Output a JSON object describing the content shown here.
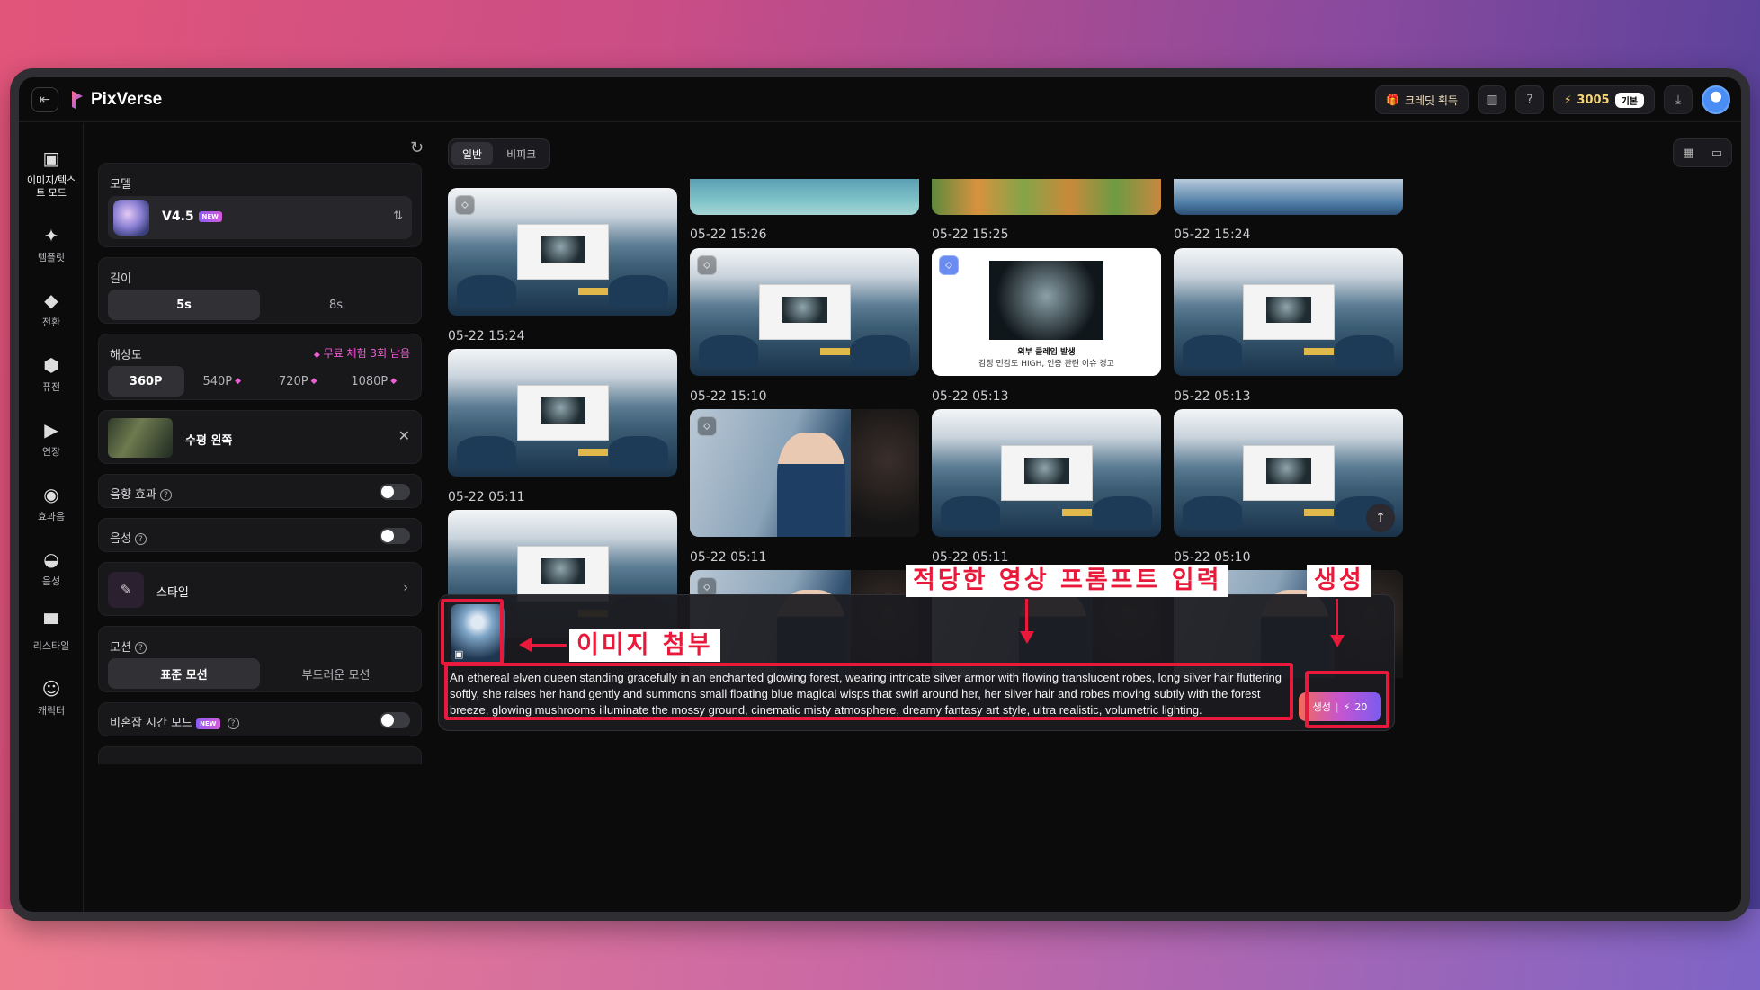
{
  "app": {
    "name": "PixVerse",
    "credits_label": "크레딧 획득",
    "credit_count": "3005",
    "plan": "기본"
  },
  "sidebar": {
    "items": [
      {
        "label": "이미지/텍스트 모드",
        "icon": "image-icon",
        "active": true
      },
      {
        "label": "템플릿",
        "icon": "sparkle-icon"
      },
      {
        "label": "전환",
        "icon": "transition-icon"
      },
      {
        "label": "퓨전",
        "icon": "cube-icon"
      },
      {
        "label": "연장",
        "icon": "extend-icon"
      },
      {
        "label": "효과음",
        "icon": "sound-wave-icon"
      },
      {
        "label": "음성",
        "icon": "lips-icon"
      },
      {
        "label": "리스타일",
        "icon": "paint-roller-icon"
      },
      {
        "label": "캐릭터",
        "icon": "smile-icon"
      }
    ]
  },
  "settings": {
    "model": {
      "label": "모델",
      "name": "V4.5",
      "badge": "NEW"
    },
    "length": {
      "label": "길이",
      "options": [
        "5s",
        "8s"
      ],
      "selected": "5s"
    },
    "resolution": {
      "label": "해상도",
      "trial_note": "무료 체험 3회 남음",
      "options": [
        "360P",
        "540P",
        "720P",
        "1080P"
      ],
      "selected": "360P"
    },
    "transition": {
      "label": "수평 왼쪽"
    },
    "sound_effect": {
      "label": "음향 효과",
      "enabled": false
    },
    "voice": {
      "label": "음성",
      "enabled": false
    },
    "style": {
      "label": "스타일"
    },
    "motion": {
      "label": "모션",
      "options": [
        "표준 모션",
        "부드러운 모션"
      ],
      "selected": "표준 모션"
    },
    "off_peak": {
      "label": "비혼잡 시간 모드",
      "badge": "NEW",
      "enabled": false
    }
  },
  "tabs": [
    "일반",
    "비피크"
  ],
  "gallery": {
    "timestamps": {
      "c1r1": "05-22 15:24",
      "c1r2": "05-22 05:11",
      "c2r1": "05-22 15:26",
      "c2r2": "05-22 15:10",
      "c2r3": "05-22 05:11",
      "c3r1": "05-22 15:25",
      "c3r2": "05-22 05:13",
      "c3r3": "05-22 05:11",
      "c4r1": "05-22 15:24",
      "c4r2": "05-22 05:13",
      "c4r3": "05-22 05:10"
    },
    "slide_caption_1": "외부 클레임 발생",
    "slide_caption_2": "감정 민감도 HIGH, 인증 관련 이슈 경고"
  },
  "prompt": {
    "text": "An ethereal elven queen standing gracefully in an enchanted glowing forest, wearing intricate silver armor with flowing translucent robes, long silver hair fluttering softly, she raises her hand gently and summons small floating blue magical wisps that swirl around her, her silver hair and robes moving subtly with the forest breeze, glowing mushrooms illuminate the mossy ground, cinematic misty atmosphere, dreamy fantasy art style, ultra realistic, volumetric lighting.",
    "generate_label": "생성",
    "cost": "20"
  },
  "annotations": {
    "attach": "이미지 첨부",
    "prompt": "적당한 영상 프롬프트 입력",
    "generate": "생성",
    "color": "#e8193a"
  }
}
